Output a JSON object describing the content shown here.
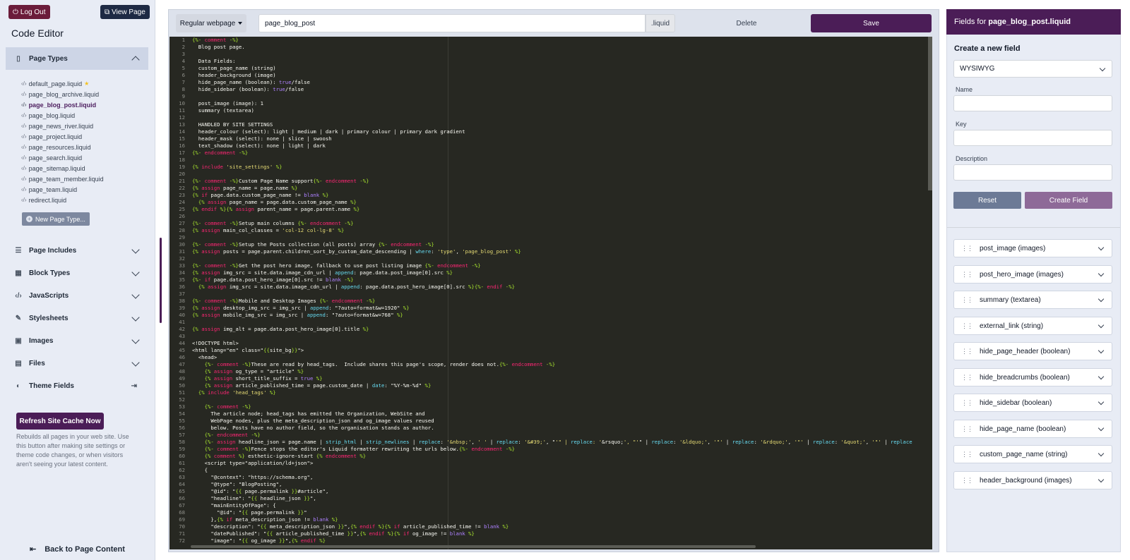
{
  "sidebar": {
    "logout_label": "Log Out",
    "view_page_label": "View Page",
    "title": "Code Editor",
    "page_types_label": "Page Types",
    "files": [
      "default_page.liquid",
      "page_blog_archive.liquid",
      "page_blog_post.liquid",
      "page_blog.liquid",
      "page_news_river.liquid",
      "page_project.liquid",
      "page_resources.liquid",
      "page_search.liquid",
      "page_sitemap.liquid",
      "page_team_member.liquid",
      "page_team.liquid",
      "redirect.liquid"
    ],
    "current_file": "page_blog_post.liquid",
    "starred_file": "default_page.liquid",
    "new_page_type_label": "New Page Type...",
    "sections": [
      {
        "label": "Page Includes",
        "icon": "list-icon"
      },
      {
        "label": "Block Types",
        "icon": "table-icon"
      },
      {
        "label": "JavaScripts",
        "icon": "code-icon"
      },
      {
        "label": "Stylesheets",
        "icon": "brush-icon"
      },
      {
        "label": "Images",
        "icon": "image-icon"
      },
      {
        "label": "Files",
        "icon": "folder-icon"
      },
      {
        "label": "Theme Fields",
        "icon": "toggle-icon"
      }
    ],
    "refresh_label": "Refresh Site Cache Now",
    "refresh_desc": "Rebuilds all pages in your web site. Use this button after making site settings or theme code changes, or when visitors aren't seeing your latest content.",
    "back_label": "Back to Page Content"
  },
  "editor": {
    "template_select": "Regular webpage",
    "filename": "page_blog_post",
    "suffix": ".liquid",
    "delete_label": "Delete",
    "save_label": "Save"
  },
  "right_panel": {
    "heading_prefix": "Fields for",
    "heading_file": "page_blog_post.liquid",
    "create_title": "Create a new field",
    "type_select": "WYSIWYG",
    "name_label": "Name",
    "key_label": "Key",
    "description_label": "Description",
    "reset_label": "Reset",
    "create_field_label": "Create Field",
    "fields": [
      "post_image (images)",
      "post_hero_image (images)",
      "summary (textarea)",
      "external_link (string)",
      "hide_page_header (boolean)",
      "hide_breadcrumbs (boolean)",
      "hide_sidebar (boolean)",
      "hide_page_name (boolean)",
      "custom_page_name (string)",
      "header_background (images)"
    ]
  },
  "code_lines": [
    "{%- comment -%}",
    "  Blog post page.",
    "",
    "  Data Fields:",
    "  custom_page_name (string)",
    "  header_background (image)",
    "  hide_page_name (boolean): true/false",
    "  hide_sidebar (boolean): true/false",
    "",
    "  post_image (image): 1",
    "  summary (textarea)",
    "",
    "  HANDLED BY SITE SETTINGS",
    "  header_colour (select): light | medium | dark | primary colour | primary dark gradient",
    "  header_mask (select): none | slice | swoosh",
    "  text_shadow (select): none | light | dark",
    "{%- endcomment -%}",
    "",
    "{% include 'site_settings' %}",
    "",
    "{%- comment -%}Custom Page Name support{%- endcomment -%}",
    "{% assign page_name = page.name %}",
    "{% if page.data.custom_page_name != blank %}",
    "  {% assign page_name = page.data.custom_page_name %}",
    "{% endif %}{% assign parent_name = page.parent.name %}",
    "",
    "{%- comment -%}Setup main columns {%- endcomment -%}",
    "{% assign main_col_classes = 'col-12 col-lg-8' %}",
    "",
    "{%- comment -%}Setup the Posts collection (all posts) array {%- endcomment -%}",
    "{% assign posts = page.parent.children_sort_by_custom_date_descending | where: 'type', 'page_blog_post' %}",
    "",
    "{%- comment -%}Get the post hero image, fallback to use post listing image {%- endcomment -%}",
    "{% assign img_src = site.data.image_cdn_url | append: page.data.post_image[0].src %}",
    "{%- if page.data.post_hero_image[0].src != blank -%}",
    "  {% assign img_src = site.data.image_cdn_url | append: page.data.post_hero_image[0].src %}{%- endif -%}",
    "",
    "{%- comment -%}Mobile and Desktop Images {%- endcomment -%}",
    "{% assign desktop_img_src = img_src | append: \"?auto=format&w=1920\" %}",
    "{% assign mobile_img_src = img_src | append: \"?auto=format&w=768\" %}",
    "",
    "{% assign img_alt = page.data.post_hero_image[0].title %}",
    "",
    "<!DOCTYPE html>",
    "<html lang=\"en\" class=\"{{site_bg}}\">",
    "  <head>",
    "    {%- comment -%}These are read by head_tags.  Include shares this page's scope, render does not.{%- endcomment -%}",
    "    {% assign og_type = \"article\" %}",
    "    {% assign short_title_suffix = true %}",
    "    {% assign article_published_time = page.custom_date | date: \"%Y-%m-%d\" %}",
    "  {% include 'head_tags' %}",
    "",
    "    {%- comment -%}",
    "      The article node; head_tags has emitted the Organization, WebSite and",
    "      WebPage nodes, plus the meta_description_json and og_image values reused",
    "      below. Posts have no author field, so the organisation stands as author.",
    "    {%- endcomment -%}",
    "    {%- assign headline_json = page.name | strip_html | strip_newlines | replace: '&nbsp;', ' ' | replace: '&#39;', \"'\" | replace: '&rsquo;', \"'\" | replace: '&ldquo;', '\"' | replace: '&rdquo;', '\"' | replace: '&quot;', '\"' | replace",
    "    {%- comment -%}Fence stops the editor's Liquid formatter rewriting the urls below.{%- endcomment -%}",
    "    {% comment %} esthetic-ignore-start {% endcomment %}",
    "    <script type=\"application/ld+json\">",
    "    {",
    "      \"@context\": \"https://schema.org\",",
    "      \"@type\": \"BlogPosting\",",
    "      \"@id\": \"{{ page.permalink }}#article\",",
    "      \"headline\": \"{{ headline_json }}\",",
    "      \"mainEntityOfPage\": {",
    "        \"@id\": \"{{ page.permalink }}\"",
    "      },{% if meta_description_json != blank %}",
    "      \"description\": \"{{ meta_description_json }}\",{% endif %}{% if article_published_time != blank %}",
    "      \"datePublished\": \"{{ article_published_time }}\",{% endif %}{% if og_image != blank %}",
    "      \"image\": \"{{ og_image }}\",{% endif %}"
  ]
}
